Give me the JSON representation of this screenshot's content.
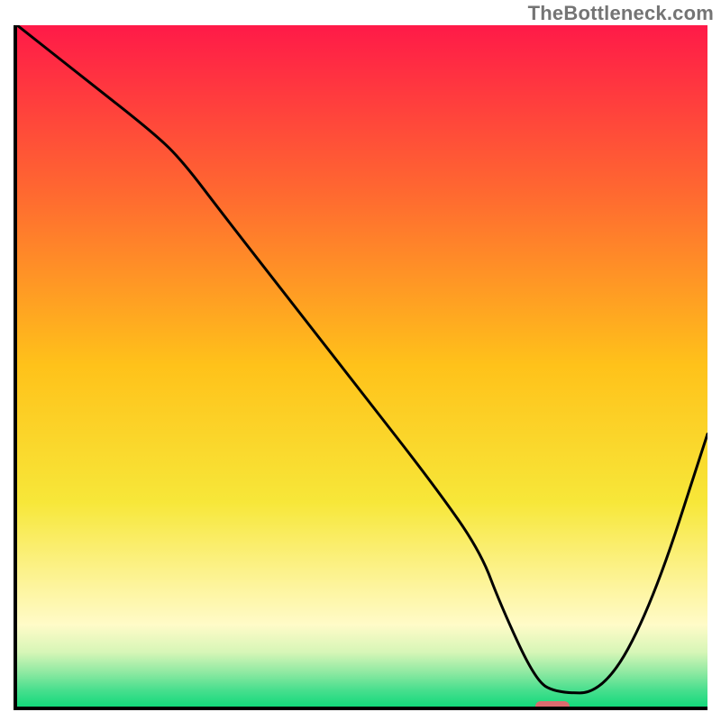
{
  "watermark": "TheBottleneck.com",
  "chart_data": {
    "type": "line",
    "title": "",
    "xlabel": "",
    "ylabel": "",
    "xlim": [
      0,
      100
    ],
    "ylim": [
      0,
      100
    ],
    "grid": false,
    "legend": false,
    "background": {
      "type": "vertical-gradient",
      "stops": [
        {
          "pos": 0.0,
          "color": "#ff1a48"
        },
        {
          "pos": 0.25,
          "color": "#ff6a30"
        },
        {
          "pos": 0.5,
          "color": "#ffc21a"
        },
        {
          "pos": 0.7,
          "color": "#f7e739"
        },
        {
          "pos": 0.82,
          "color": "#fdf49a"
        },
        {
          "pos": 0.88,
          "color": "#fffbc8"
        },
        {
          "pos": 0.92,
          "color": "#d7f6b7"
        },
        {
          "pos": 0.95,
          "color": "#8ee9a2"
        },
        {
          "pos": 0.975,
          "color": "#4adf8e"
        },
        {
          "pos": 1.0,
          "color": "#14d97c"
        }
      ]
    },
    "series": [
      {
        "name": "bottleneck-curve",
        "x": [
          0,
          10,
          20,
          24,
          30,
          40,
          50,
          60,
          67,
          70,
          75,
          78,
          85,
          92,
          100
        ],
        "y": [
          100,
          92,
          84,
          80,
          72,
          59,
          46,
          33,
          23,
          15,
          4,
          2,
          2,
          15,
          40
        ],
        "color": "#000000",
        "stroke_width": 3
      }
    ],
    "marker": {
      "name": "optimum-marker",
      "x_range": [
        75,
        80
      ],
      "y": 0,
      "color": "#dd6a6f",
      "shape": "pill"
    }
  }
}
